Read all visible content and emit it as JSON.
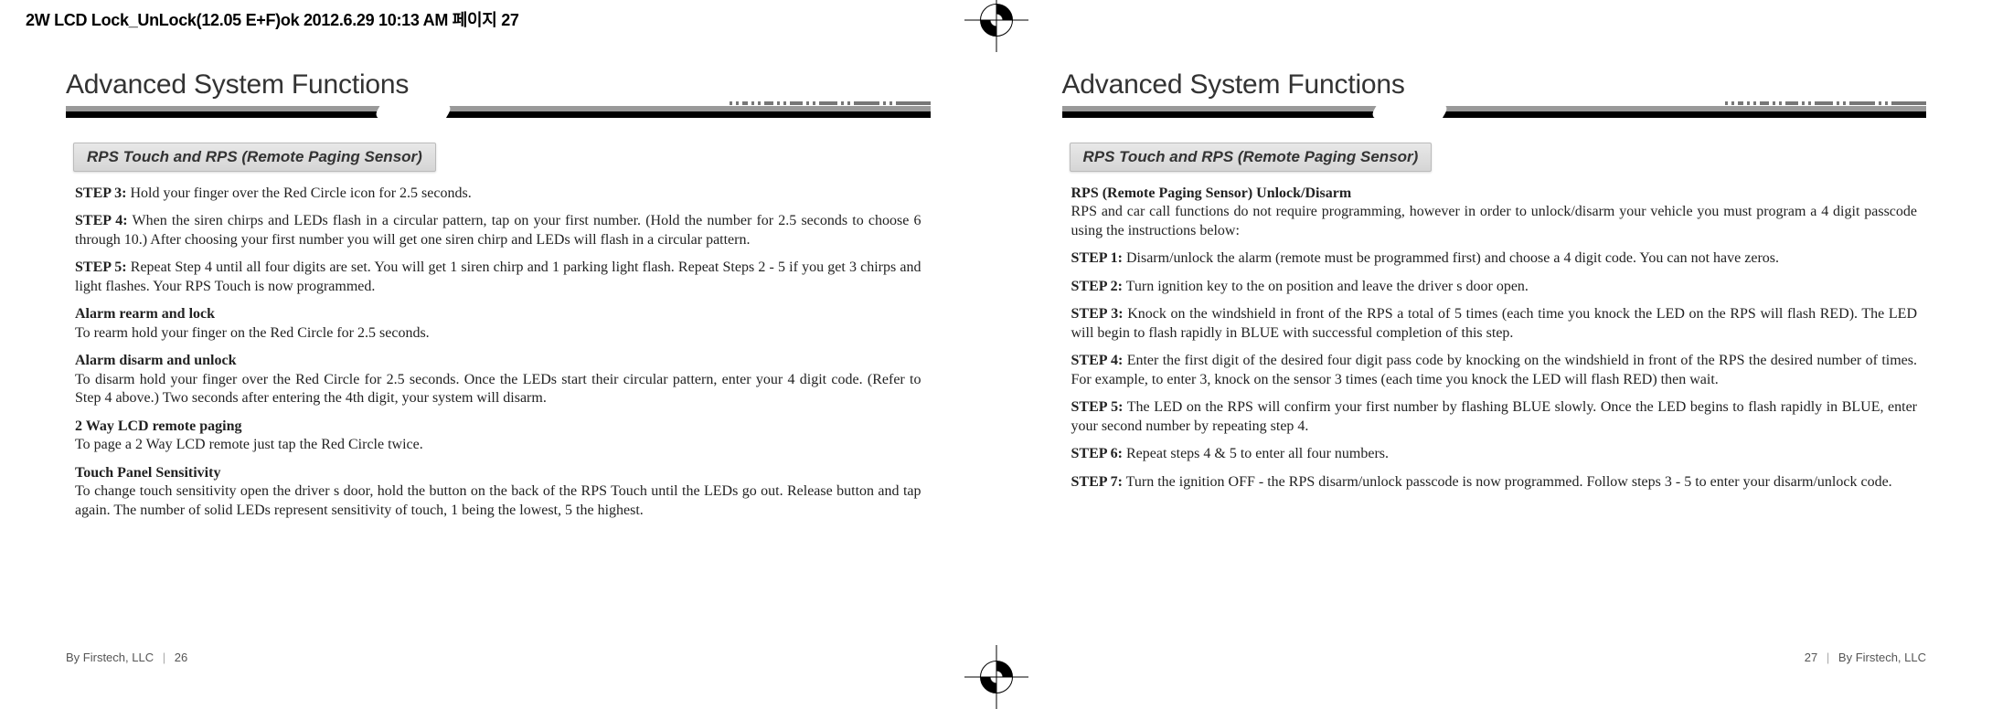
{
  "print_header": "2W LCD Lock_UnLock(12.05 E+F)ok  2012.6.29 10:13 AM  페이지 27",
  "left": {
    "title": "Advanced System Functions",
    "section": "RPS Touch and RPS (Remote Paging Sensor)",
    "step3_lead": "STEP 3:",
    "step3_text": " Hold your finger over the  Red Circle  icon for 2.5 seconds.",
    "step4_lead": "STEP 4:",
    "step4_text": " When the siren chirps and LEDs flash in a circular pattern, tap on your first number. (Hold the number for 2.5 seconds to choose 6 through 10.) After choosing your first number you will get one siren chirp and LEDs will flash in a circular pattern.",
    "step5_lead": "STEP 5:",
    "step5_text": " Repeat Step 4 until all four digits are set. You will get 1 siren chirp and 1 parking light flash. Repeat Steps 2 - 5 if you get 3 chirps and light flashes. Your RPS Touch is now programmed.",
    "h_rearm": "Alarm rearm and lock",
    "p_rearm": "To rearm hold your finger on the  Red Circle  for 2.5 seconds.",
    "h_disarm": "Alarm disarm and unlock",
    "p_disarm": "To disarm hold your finger over the  Red Circle  for 2.5 seconds. Once the LEDs start their circular pattern, enter your 4 digit code. (Refer to Step 4 above.) Two seconds after entering the 4th digit, your system will disarm.",
    "h_paging": "2 Way LCD remote paging",
    "p_paging": "To page a 2 Way LCD remote just tap the  Red Circle  twice.",
    "h_sens": "Touch Panel Sensitivity",
    "p_sens": "To change touch sensitivity open the driver s door, hold the button on the back of the RPS Touch until the LEDs go out. Release button and tap again. The number of solid LEDs represent sensitivity of touch, 1 being the lowest, 5 the highest.",
    "footer_brand": "By Firstech, LLC",
    "footer_page": "26"
  },
  "right": {
    "title": "Advanced System Functions",
    "section": "RPS Touch and RPS (Remote Paging Sensor)",
    "h_rps": "RPS (Remote Paging Sensor) Unlock/Disarm",
    "p_intro": "RPS and car call functions do not require programming, however in order to unlock/disarm your vehicle you must program a 4 digit passcode using the instructions below:",
    "step1_lead": "STEP 1:",
    "step1_text": " Disarm/unlock the alarm (remote must be programmed first) and choose a 4 digit code. You can not have zeros.",
    "step2_lead": "STEP 2:",
    "step2_text": " Turn ignition key to the  on  position and leave the driver s door open.",
    "step3_lead": "STEP 3:",
    "step3_text": " Knock on the windshield in front of the RPS a total of 5 times (each time you knock the LED on the RPS will flash RED). The LED will begin to flash rapidly in BLUE with successful completion of this step.",
    "step4_lead": "STEP 4:",
    "step4_text": " Enter the first digit of the desired four digit pass code by knocking on the windshield in front of the RPS the desired number of times. For example, to enter 3, knock on the sensor 3 times (each time you knock the LED will flash RED) then wait.",
    "step5_lead": "STEP 5:",
    "step5_text": " The LED on the RPS will confirm your first number by flashing BLUE slowly. Once the LED begins to flash rapidly in BLUE, enter your second number by repeating step 4.",
    "step6_lead": "STEP 6:",
    "step6_text": " Repeat steps 4 & 5 to enter all four numbers.",
    "step7_lead": "STEP 7:",
    "step7_text": " Turn the ignition OFF - the RPS disarm/unlock passcode is now programmed. Follow steps 3 -  5 to enter your disarm/unlock code.",
    "footer_brand": "By Firstech, LLC",
    "footer_page": "27"
  }
}
